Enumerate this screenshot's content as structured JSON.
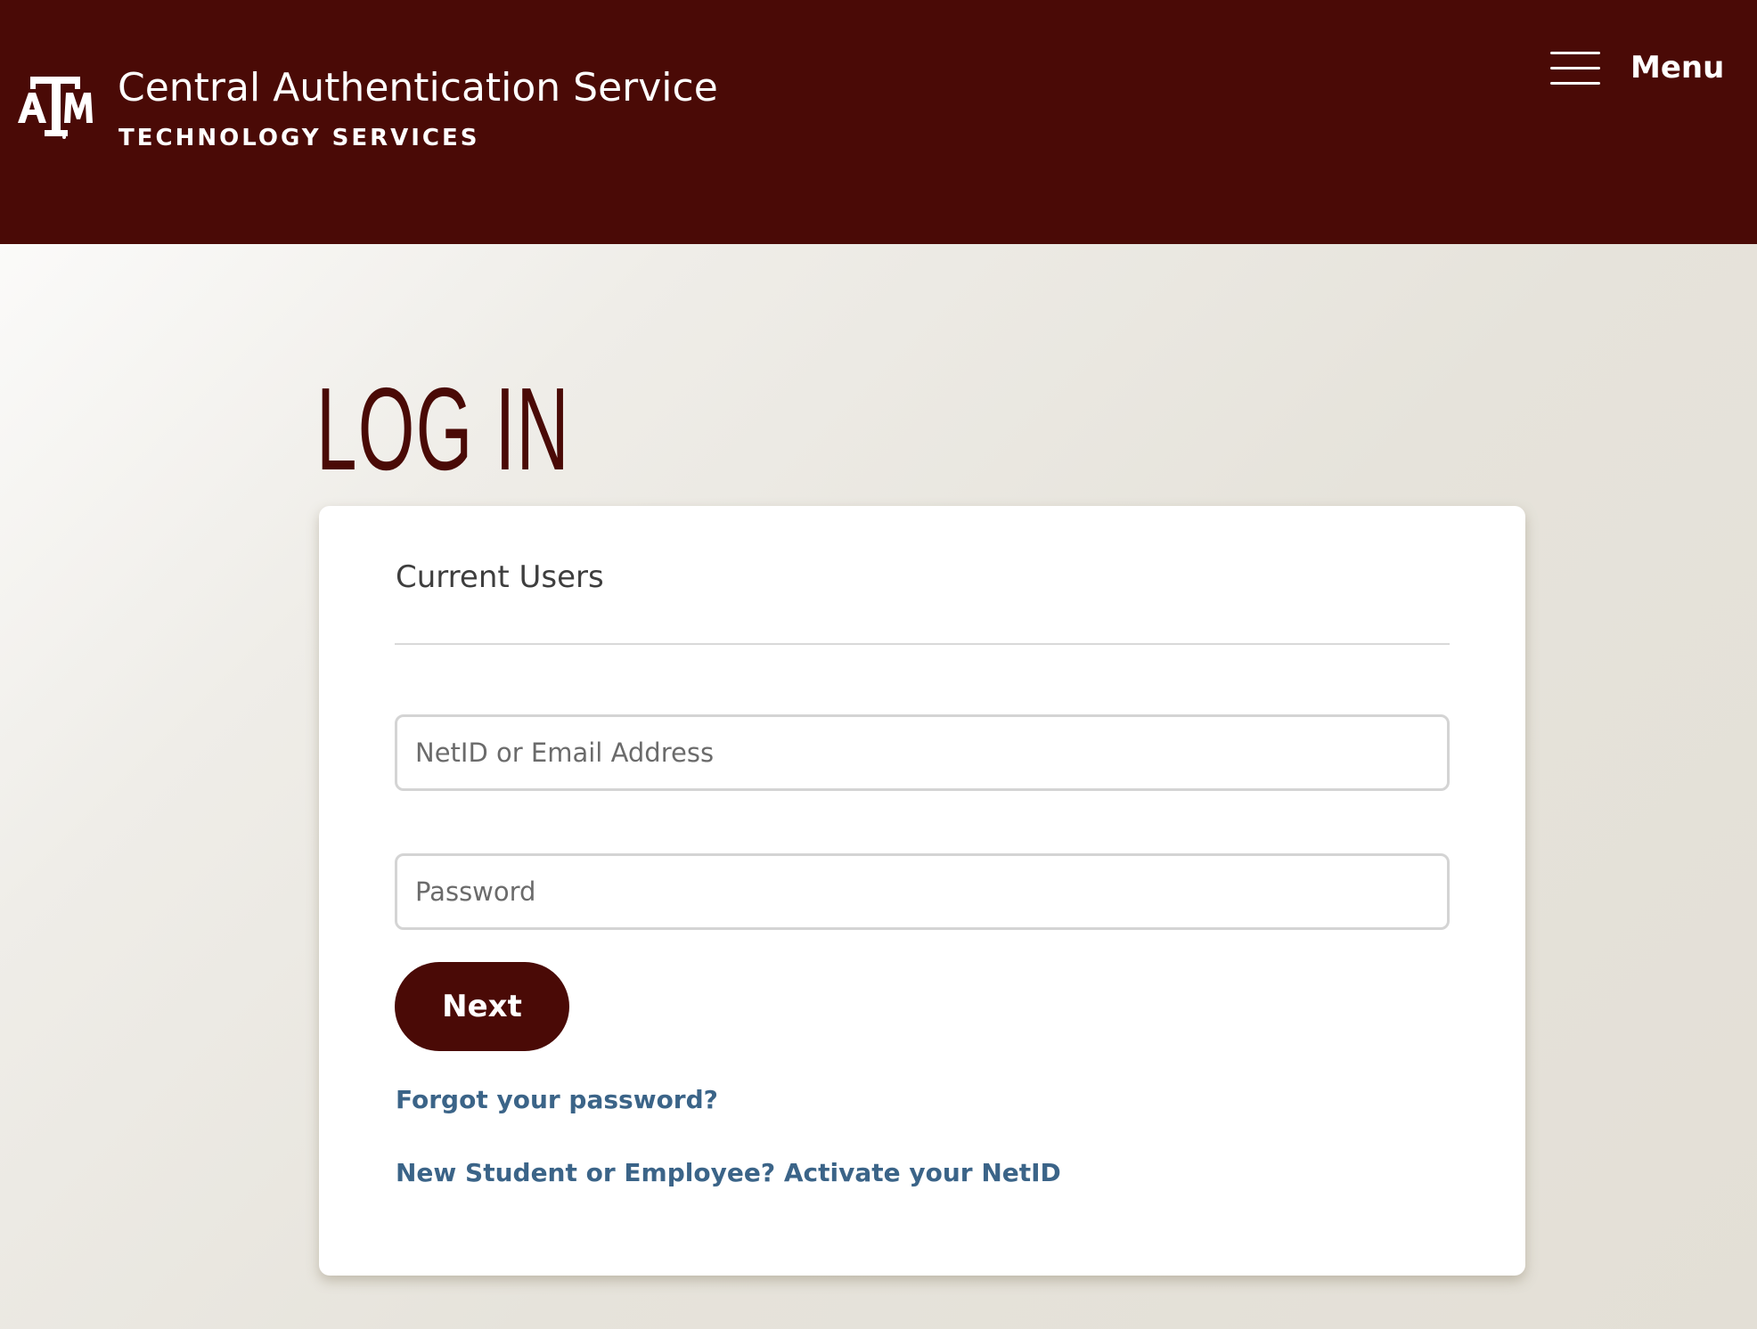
{
  "colors": {
    "brand_maroon": "#4a0a06",
    "link_blue": "#3b6488",
    "header_text": "#ffffff"
  },
  "header": {
    "logo_icon": "atm-logo-icon",
    "title": "Central Authentication Service",
    "subtitle": "TECHNOLOGY SERVICES",
    "menu_icon": "hamburger-icon",
    "menu_label": "Menu"
  },
  "main": {
    "heading": "LOG IN",
    "card": {
      "title": "Current Users",
      "netid_placeholder": "NetID or Email Address",
      "netid_value": "",
      "password_placeholder": "Password",
      "password_value": "",
      "next_label": "Next",
      "forgot_link": "Forgot your password?",
      "activate_link": "New Student or Employee? Activate your NetID"
    }
  }
}
